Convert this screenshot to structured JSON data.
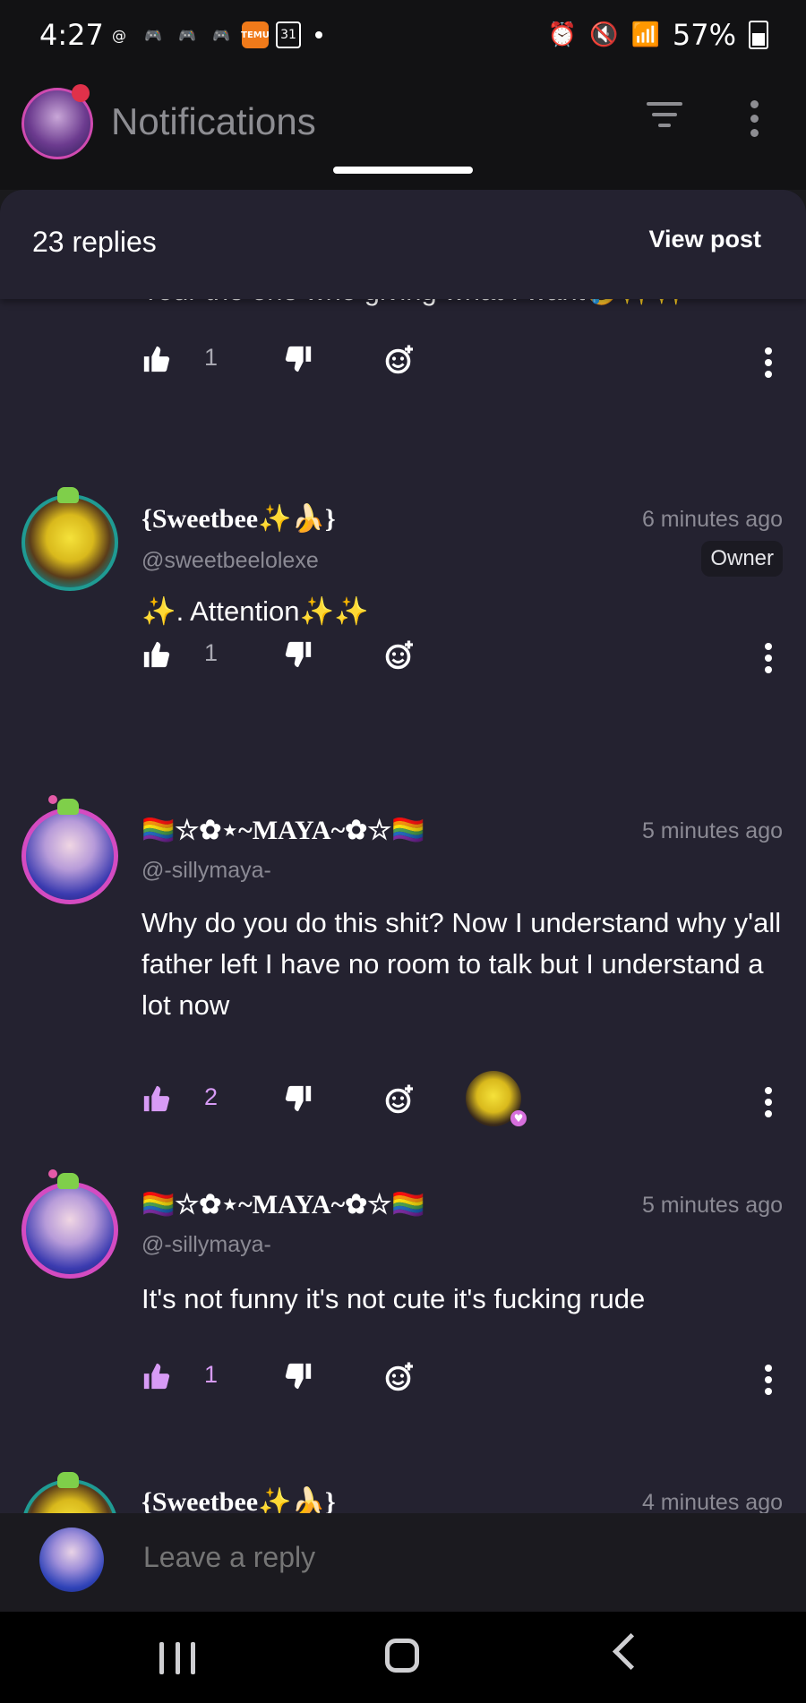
{
  "status_bar": {
    "time": "4:27",
    "calendar_day": "31",
    "temu_label": "TEMU",
    "battery": "57%",
    "icons_left": [
      "threads-icon",
      "game-controller-icon",
      "game-controller-icon",
      "game-controller-icon",
      "temu-icon",
      "calendar-icon"
    ],
    "icons_right": [
      "alarm-icon",
      "mute-icon",
      "wifi-icon",
      "signal-icon",
      "battery-icon"
    ]
  },
  "header": {
    "title": "Notifications"
  },
  "sheet": {
    "replies_count": "23 replies",
    "view_post_label": "View post"
  },
  "comments": [
    {
      "id": "c0",
      "text": "Your the one who giving what I want🤣✨✨",
      "likes": "1",
      "liked": false
    },
    {
      "id": "c1",
      "name": "{Sweetbee✨🍌}",
      "handle": "@sweetbeelolexe",
      "time": "6 minutes ago",
      "badge": "Owner",
      "text": "✨. Attention✨✨",
      "likes": "1",
      "liked": false
    },
    {
      "id": "c2",
      "name": "🏳️‍🌈☆✿⋆~MAYA~✿☆🏳️‍🌈",
      "handle": "@-sillymaya-",
      "time": "5 minutes ago",
      "text": "Why do you do this shit? Now I understand why y'all father left I have no room to talk but I understand a lot now",
      "likes": "2",
      "liked": true
    },
    {
      "id": "c3",
      "name": "🏳️‍🌈☆✿⋆~MAYA~✿☆🏳️‍🌈",
      "handle": "@-sillymaya-",
      "time": "5 minutes ago",
      "text": "It's not funny it's not cute it's fucking rude",
      "likes": "1",
      "liked": true
    },
    {
      "id": "c4",
      "name": "{Sweetbee✨🍌}",
      "time": "4 minutes ago"
    }
  ],
  "reply_bar": {
    "placeholder": "Leave a reply"
  },
  "colors": {
    "background": "#1a1a1d",
    "sheet": "#242230",
    "like_active": "#d79bf5",
    "muted_text": "#8b8a94",
    "owner_badge_bg": "#1b1a22"
  }
}
